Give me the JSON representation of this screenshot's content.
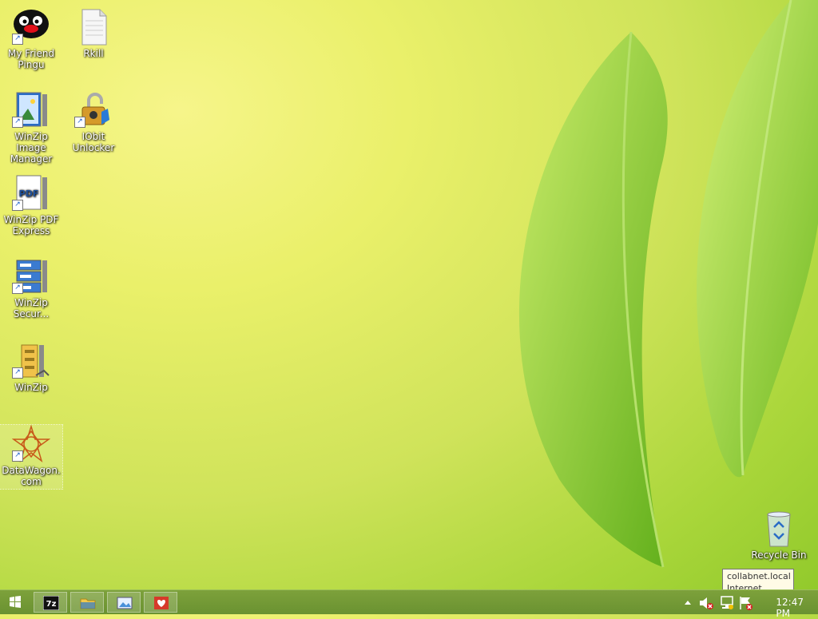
{
  "desktop": {
    "icons": [
      {
        "label": "My Friend Pingu",
        "icon": "penguin-icon"
      },
      {
        "label": "Rkill",
        "icon": "document-icon"
      },
      {
        "label": "WinZip Image Manager",
        "icon": "winzip-image-icon"
      },
      {
        "label": "IObit Unlocker",
        "icon": "unlock-icon"
      },
      {
        "label": "WinZip PDF Express",
        "icon": "pdf-icon"
      },
      {
        "label": "WinZip Secur...",
        "icon": "winzip-secure-icon"
      },
      {
        "label": "WinZip",
        "icon": "winzip-icon"
      },
      {
        "label": "DataWagon.com",
        "icon": "star-logo-icon"
      },
      {
        "label": "Recycle Bin",
        "icon": "recycle-bin-icon"
      }
    ]
  },
  "taskbar": {
    "pinned": [
      {
        "name": "7-zip",
        "icon": "7zip-icon",
        "text": "7z"
      },
      {
        "name": "file-explorer",
        "icon": "folder-icon"
      },
      {
        "name": "image-viewer",
        "icon": "image-viewer-icon"
      },
      {
        "name": "health-app",
        "icon": "heart-icon"
      }
    ],
    "clock": "12:47 PM"
  },
  "tooltip": {
    "line1": "collabnet.local",
    "line2": "Internet access"
  },
  "colors": {
    "taskbar": "#6f9734",
    "wallpaper_light": "#f6f58a",
    "wallpaper_green": "#9bd035"
  }
}
